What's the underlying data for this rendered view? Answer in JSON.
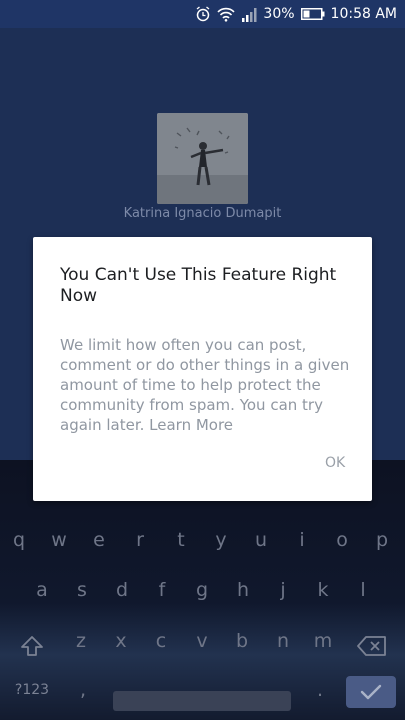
{
  "status_bar": {
    "battery_percent": "30%",
    "time": "10:58 AM",
    "icons": [
      "alarm-icon",
      "wifi-icon",
      "signal-icon",
      "battery-icon"
    ]
  },
  "profile": {
    "name": "Katrina Ignacio Dumapit"
  },
  "dialog": {
    "title": "You Can't Use This Feature Right Now",
    "message": "We limit how often you can post, comment or do other things in a given amount of time to help protect the community from spam. You can try again later.",
    "link": "Learn More",
    "ok_label": "OK"
  },
  "keyboard": {
    "row1": [
      "q",
      "w",
      "e",
      "r",
      "t",
      "y",
      "u",
      "i",
      "o",
      "p"
    ],
    "row2": [
      "a",
      "s",
      "d",
      "f",
      "g",
      "h",
      "j",
      "k",
      "l"
    ],
    "row3": [
      "z",
      "x",
      "c",
      "v",
      "b",
      "n",
      "m"
    ],
    "symbols_label": "?123",
    "comma": ",",
    "period": ".",
    "icons": [
      "shift-icon",
      "backspace-icon",
      "enter-check-icon"
    ]
  },
  "colors": {
    "app_bg": "#1d2f55",
    "status_bar_bg": "#1f3566",
    "dialog_bg": "#ffffff"
  }
}
